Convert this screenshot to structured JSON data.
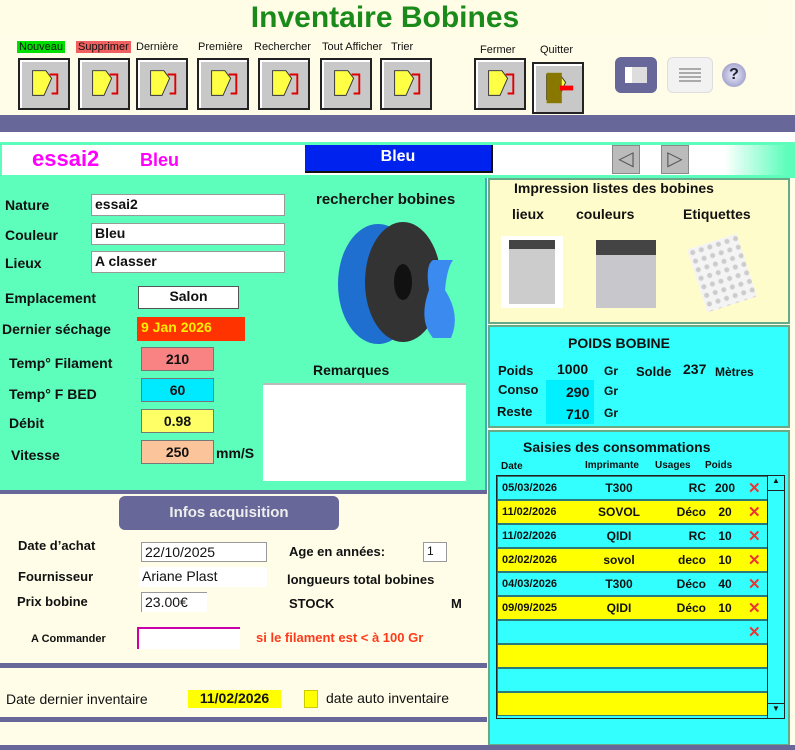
{
  "title": "Inventaire Bobines",
  "toolbar": [
    {
      "label": "Nouveau",
      "bg": "#00e000"
    },
    {
      "label": "Supprimer",
      "bg": "#f06060"
    },
    {
      "label": "Dernière"
    },
    {
      "label": "Première"
    },
    {
      "label": "Rechercher"
    },
    {
      "label": "Tout Afficher"
    },
    {
      "label": "Trier"
    },
    {
      "label": "Fermer"
    },
    {
      "label": "Quitter"
    }
  ],
  "header": {
    "name": "essai2",
    "color": "Bleu",
    "color_box": "Bleu"
  },
  "fields": {
    "nature_label": "Nature",
    "nature": "essai2",
    "couleur_label": "Couleur",
    "couleur": "Bleu",
    "lieux_label": "Lieux",
    "lieux": "A  classer",
    "emplacement_label": "Emplacement",
    "emplacement": "Salon",
    "sechage_label": "Dernier séchage",
    "sechage": "9 Jan 2026",
    "temp_fil_label": "Temp° Filament",
    "temp_fil": "210",
    "temp_bed_label": "Temp° F BED",
    "temp_bed": "60",
    "debit_label": "Débit",
    "debit": "0.98",
    "vitesse_label": "Vitesse",
    "vitesse": "250",
    "vitesse_unit": "mm/S",
    "search_label": "rechercher bobines",
    "remarques_label": "Remarques"
  },
  "print": {
    "title": "Impression listes des bobines",
    "lieux": "lieux",
    "couleurs": "couleurs",
    "etiquettes": "Etiquettes"
  },
  "poids": {
    "title": "POIDS BOBINE",
    "poids_label": "Poids",
    "poids": "1000",
    "conso_label": "Conso",
    "conso": "290",
    "reste_label": "Reste",
    "reste": "710",
    "unit": "Gr",
    "solde_label": "Solde",
    "solde": "237",
    "solde_unit": "Mètres"
  },
  "conso": {
    "title": "Saisies des consommations",
    "headers": [
      "Date",
      "Imprimante",
      "Usages",
      "Poids"
    ],
    "rows": [
      [
        "05/03/2026",
        "T300",
        "RC",
        "200"
      ],
      [
        "11/02/2026",
        "SOVOL",
        "Déco",
        "20"
      ],
      [
        "11/02/2026",
        "QIDI",
        "RC",
        "10"
      ],
      [
        "02/02/2026",
        "sovol",
        "deco",
        "10"
      ],
      [
        "04/03/2026",
        "T300",
        "Déco",
        "40"
      ],
      [
        "09/09/2025",
        "QIDI",
        "Déco",
        "10"
      ]
    ]
  },
  "acq": {
    "title": "Infos acquisition",
    "date_label": "Date d’achat",
    "date": "22/10/2025",
    "age_label": "Age en années:",
    "age": "1",
    "fourn_label": "Fournisseur",
    "fourn": "Ariane Plast",
    "longueurs": "longueurs total bobines",
    "prix_label": "Prix bobine",
    "prix": "23.00€",
    "stock": "STOCK",
    "stock_unit": "M",
    "commander_label": "A Commander",
    "commander_note": "si le filament est < à 100 Gr"
  },
  "inventaire": {
    "label": "Date dernier inventaire",
    "date": "11/02/2026",
    "auto_label": "date auto inventaire"
  }
}
